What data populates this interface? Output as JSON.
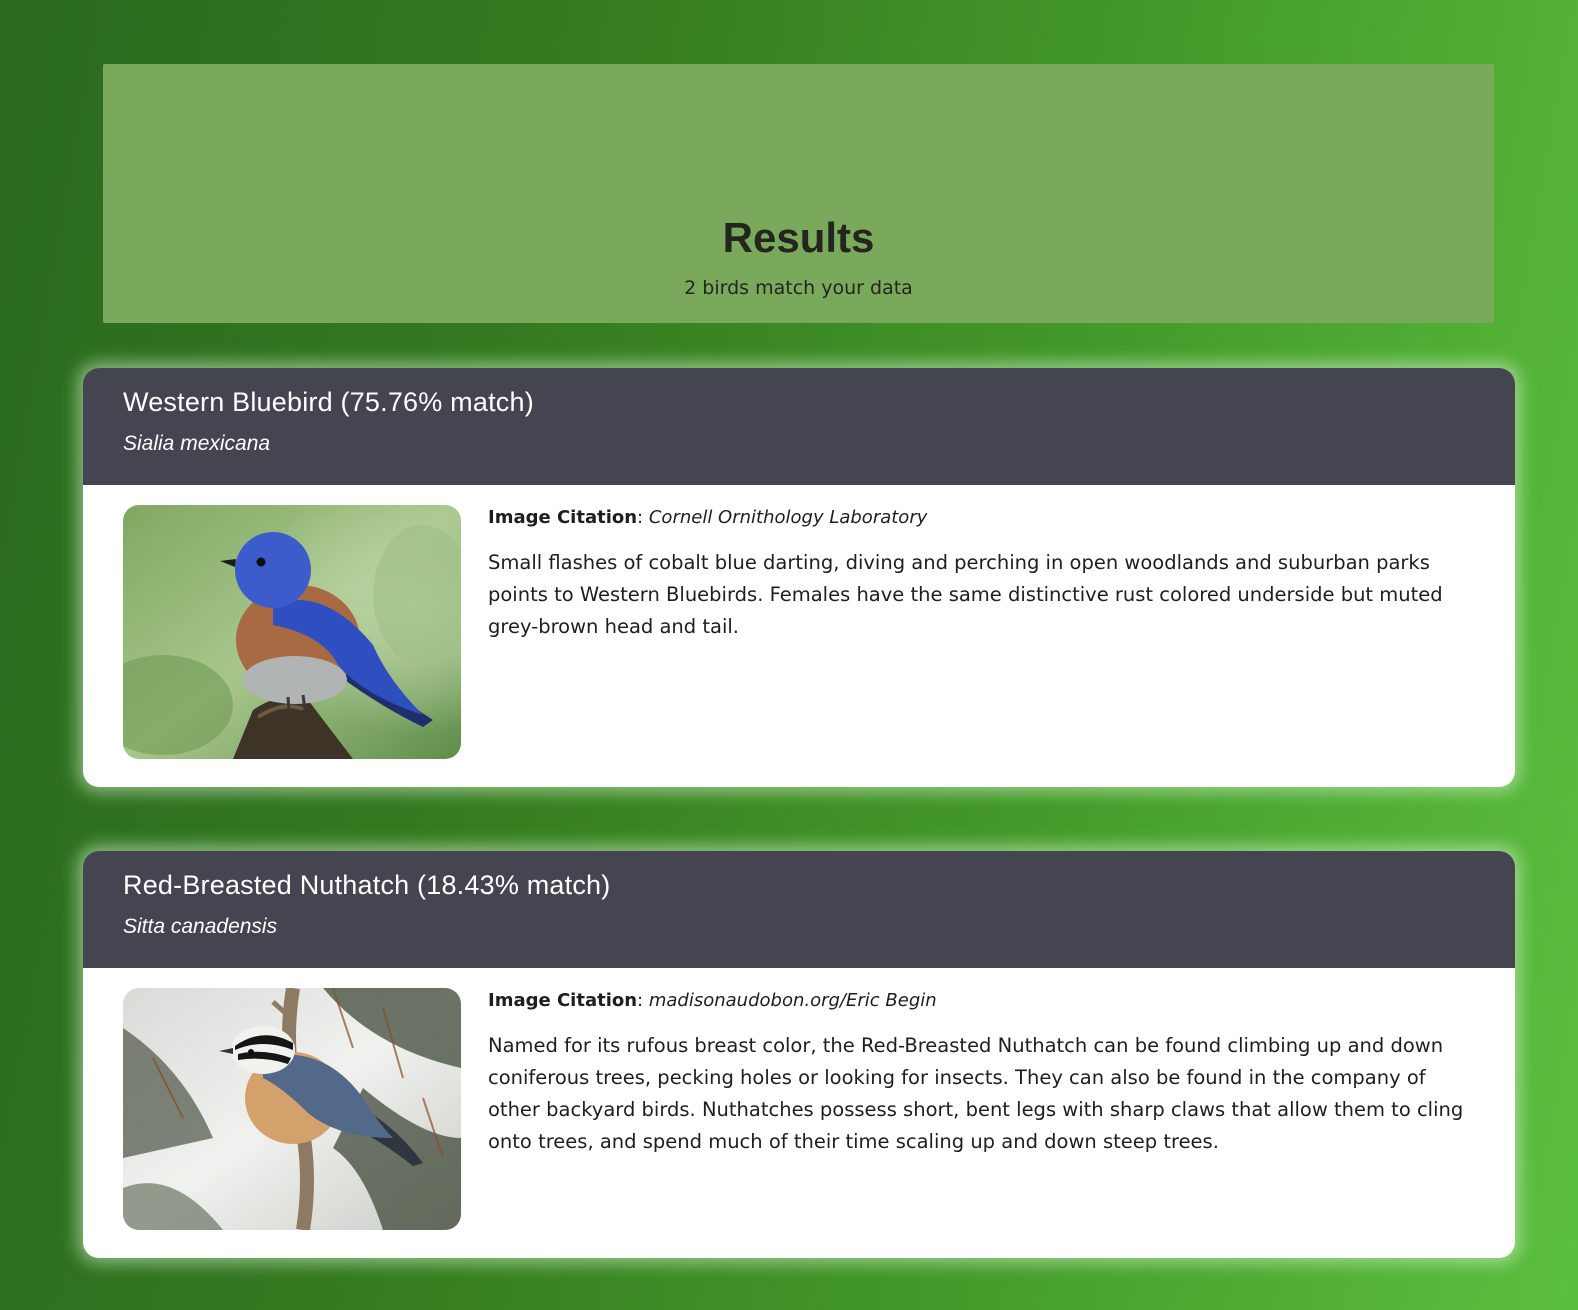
{
  "header": {
    "title": "Results",
    "subtitle": "2 birds match your data"
  },
  "results": [
    {
      "title": "Western Bluebird (75.76% match)",
      "scientific_name": "Sialia mexicana",
      "citation_label": "Image Citation",
      "citation_sep": ":",
      "citation_source": "Cornell Ornithology Laboratory",
      "description": "Small flashes of cobalt blue darting, diving and perching in open woodlands and suburban parks points to Western Bluebirds. Females have the same distinctive rust colored underside but muted grey-brown head and tail."
    },
    {
      "title": "Red-Breasted Nuthatch (18.43% match)",
      "scientific_name": "Sitta canadensis",
      "citation_label": "Image Citation",
      "citation_sep": ":",
      "citation_source": "madisonaudobon.org/Eric Begin",
      "description": "Named for its rufous breast color, the Red-Breasted Nuthatch can be found climbing up and down coniferous trees, pecking holes or looking for insects. They can also be found in the company of other backyard birds. Nuthatches possess short, bent legs with sharp claws that allow them to cling onto trees, and spend much of their time scaling up and down steep trees."
    }
  ],
  "colors": {
    "background_start": "#2b6a1f",
    "background_end": "#5bbf3e",
    "hero_panel": "#7ba95c",
    "card_header": "#444550",
    "card_body": "#ffffff"
  }
}
